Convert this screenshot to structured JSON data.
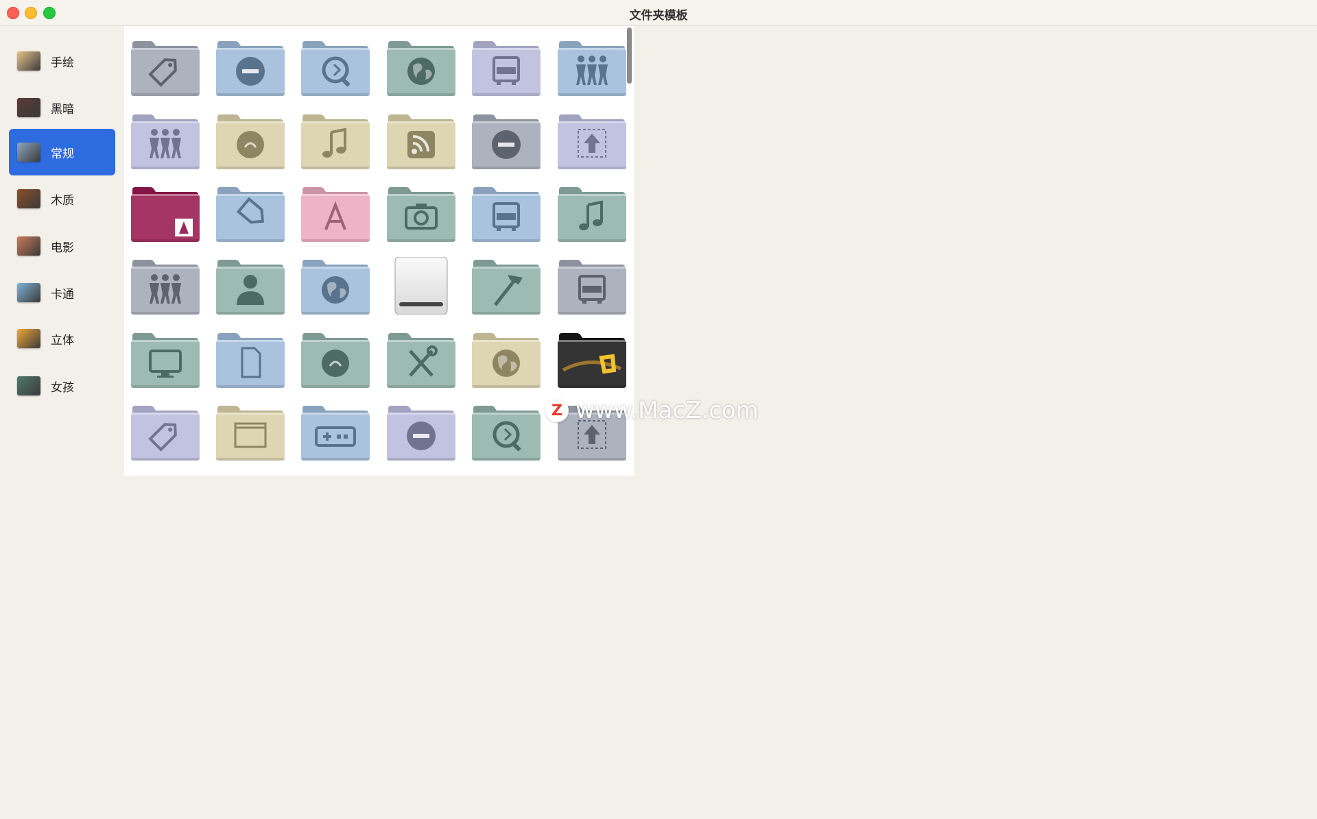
{
  "window": {
    "title": "文件夹模板"
  },
  "sidebar": {
    "items": [
      {
        "label": "手绘",
        "icon": "hand-drawn-folder-icon",
        "color": "#e7c38b",
        "active": false
      },
      {
        "label": "黑暗",
        "icon": "dark-folder-icon",
        "color": "#5a3b34",
        "active": false
      },
      {
        "label": "常规",
        "icon": "regular-folder-icon",
        "color": "#8fa6c2",
        "active": true
      },
      {
        "label": "木质",
        "icon": "wood-folder-icon",
        "color": "#8b4f2b",
        "active": false
      },
      {
        "label": "电影",
        "icon": "movie-folder-icon",
        "color": "#c97b5a",
        "active": false
      },
      {
        "label": "卡通",
        "icon": "cartoon-folder-icon",
        "color": "#7fb3d6",
        "active": false
      },
      {
        "label": "立体",
        "icon": "3d-folder-icon",
        "color": "#f0a63a",
        "active": false
      },
      {
        "label": "女孩",
        "icon": "girl-folder-icon",
        "color": "#4f7a6b",
        "active": false
      }
    ]
  },
  "palette": {
    "graphite": "#a3a8b5",
    "blue": "#9fb8d3",
    "sage": "#93b0a9",
    "lavender": "#b8b9d7",
    "sand": "#d4cca8",
    "pink": "#e3a9bd",
    "magenta": "#9a2b5a",
    "dark": "#2a2a2a"
  },
  "folders": [
    {
      "color": "graphite",
      "glyph": "tag"
    },
    {
      "color": "blue",
      "glyph": "minus"
    },
    {
      "color": "blue",
      "glyph": "quicktime"
    },
    {
      "color": "sage",
      "glyph": "globe"
    },
    {
      "color": "lavender",
      "glyph": "truck"
    },
    {
      "color": "blue",
      "glyph": "people"
    },
    {
      "color": "lavender",
      "glyph": "people"
    },
    {
      "color": "sand",
      "glyph": "yinyang"
    },
    {
      "color": "sand",
      "glyph": "music"
    },
    {
      "color": "sand",
      "glyph": "rss"
    },
    {
      "color": "graphite",
      "glyph": "minus"
    },
    {
      "color": "lavender",
      "glyph": "upload"
    },
    {
      "color": "magenta",
      "glyph": "adobe"
    },
    {
      "color": "blue",
      "glyph": "bookmark"
    },
    {
      "color": "pink",
      "glyph": "appstore"
    },
    {
      "color": "sage",
      "glyph": "camera"
    },
    {
      "color": "blue",
      "glyph": "truck"
    },
    {
      "color": "sage",
      "glyph": "music"
    },
    {
      "color": "graphite",
      "glyph": "people"
    },
    {
      "color": "sage",
      "glyph": "user"
    },
    {
      "color": "blue",
      "glyph": "globe"
    },
    {
      "color": "drive",
      "glyph": "drive"
    },
    {
      "color": "sage",
      "glyph": "hammer"
    },
    {
      "color": "graphite",
      "glyph": "truck"
    },
    {
      "color": "sage",
      "glyph": "monitor"
    },
    {
      "color": "blue",
      "glyph": "document"
    },
    {
      "color": "sage",
      "glyph": "yinyang"
    },
    {
      "color": "sage",
      "glyph": "tools"
    },
    {
      "color": "sand",
      "glyph": "globe"
    },
    {
      "color": "dark",
      "glyph": "office"
    },
    {
      "color": "lavender",
      "glyph": "tag"
    },
    {
      "color": "sand",
      "glyph": "window"
    },
    {
      "color": "blue",
      "glyph": "gamepad"
    },
    {
      "color": "lavender",
      "glyph": "minus"
    },
    {
      "color": "sage",
      "glyph": "quicktime"
    },
    {
      "color": "graphite",
      "glyph": "upload"
    }
  ],
  "watermark": {
    "logo": "Z",
    "text": "www.MacZ.com"
  }
}
